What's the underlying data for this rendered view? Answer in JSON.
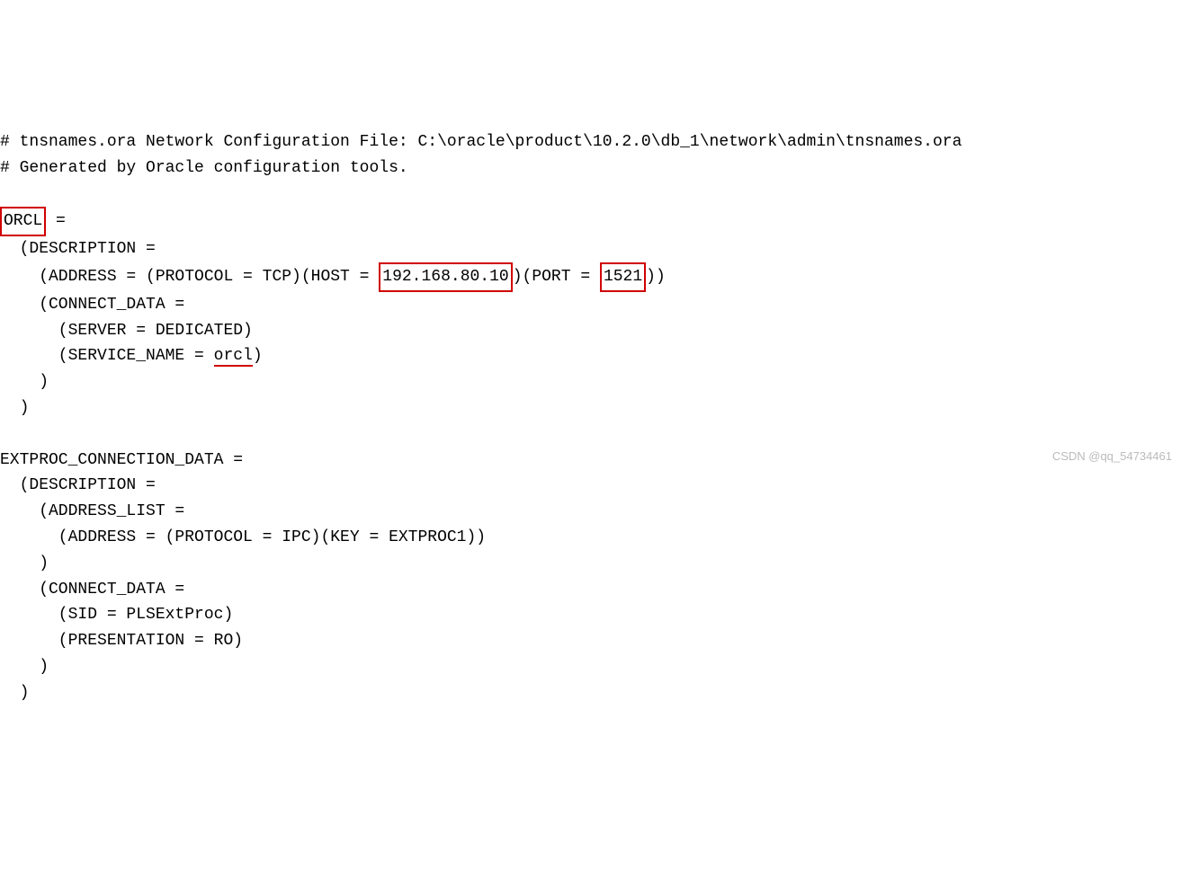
{
  "comment1": "# tnsnames.ora Network Configuration File: C:\\oracle\\product\\10.2.0\\db_1\\network\\admin\\tnsnames.ora",
  "comment2": "# Generated by Oracle configuration tools.",
  "orcl": {
    "name": "ORCL",
    "eq": " =",
    "desc_open": "  (DESCRIPTION =",
    "addr_pre": "    (ADDRESS = (PROTOCOL = TCP)(HOST = ",
    "host": "192.168.80.10",
    "addr_mid": ")(PORT = ",
    "port": "1521",
    "addr_post": "))",
    "connect_open": "    (CONNECT_DATA =",
    "server": "      (SERVER = DEDICATED)",
    "svc_pre": "      (SERVICE_NAME = ",
    "service": "orcl",
    "svc_post": ")",
    "close1": "    )",
    "close2": "  )"
  },
  "ext": {
    "name": "EXTPROC_CONNECTION_DATA =",
    "desc_open": "  (DESCRIPTION =",
    "addrlist_open": "    (ADDRESS_LIST =",
    "address": "      (ADDRESS = (PROTOCOL = IPC)(KEY = EXTPROC1))",
    "addrlist_close": "    )",
    "connect_open": "    (CONNECT_DATA =",
    "sid": "      (SID = PLSExtProc)",
    "presentation": "      (PRESENTATION = RO)",
    "close1": "    )",
    "close2": "  )"
  },
  "watermark": "CSDN @qq_54734461"
}
